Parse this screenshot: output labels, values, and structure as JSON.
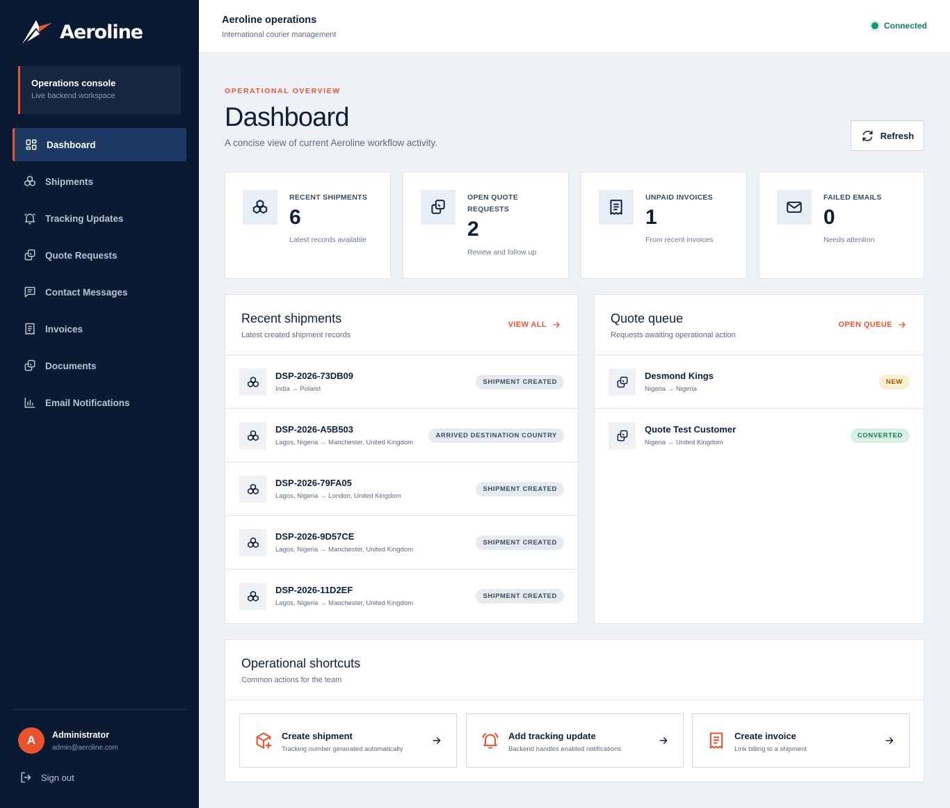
{
  "brand": {
    "name": "Aeroline"
  },
  "console": {
    "title": "Operations console",
    "subtitle": "Live backend workspace"
  },
  "nav": [
    {
      "label": "Dashboard",
      "icon": "dashboard-icon",
      "active": true
    },
    {
      "label": "Shipments",
      "icon": "boxes-icon"
    },
    {
      "label": "Tracking Updates",
      "icon": "bell-icon"
    },
    {
      "label": "Quote Requests",
      "icon": "copy-icon"
    },
    {
      "label": "Contact Messages",
      "icon": "message-icon"
    },
    {
      "label": "Invoices",
      "icon": "receipt-icon"
    },
    {
      "label": "Documents",
      "icon": "copy-icon"
    },
    {
      "label": "Email Notifications",
      "icon": "bar-chart-icon"
    }
  ],
  "user": {
    "initial": "A",
    "name": "Administrator",
    "email": "admin@aeroline.com"
  },
  "signout": {
    "label": "Sign out"
  },
  "topbar": {
    "title": "Aeroline operations",
    "subtitle": "International courier management",
    "status": "Connected"
  },
  "header": {
    "eyebrow": "OPERATIONAL OVERVIEW",
    "title": "Dashboard",
    "subtitle": "A concise view of current Aeroline workflow activity.",
    "refresh_label": "Refresh"
  },
  "stats": [
    {
      "label": "RECENT SHIPMENTS",
      "value": "6",
      "note": "Latest records available",
      "icon": "boxes-icon"
    },
    {
      "label": "OPEN QUOTE REQUESTS",
      "value": "2",
      "note": "Review and follow up",
      "icon": "copy-icon"
    },
    {
      "label": "UNPAID INVOICES",
      "value": "1",
      "note": "From recent invoices",
      "icon": "receipt-icon"
    },
    {
      "label": "FAILED EMAILS",
      "value": "0",
      "note": "Needs attention",
      "icon": "mail-icon"
    }
  ],
  "shipments_panel": {
    "title": "Recent shipments",
    "subtitle": "Latest created shipment records",
    "link": "VIEW ALL",
    "rows": [
      {
        "id": "DSP-2026-73DB09",
        "route": "India → Poland",
        "status": "SHIPMENT CREATED"
      },
      {
        "id": "DSP-2026-A5B503",
        "route": "Lagos, Nigeria → Manchester, United Kingdom",
        "status": "ARRIVED DESTINATION COUNTRY"
      },
      {
        "id": "DSP-2026-79FA05",
        "route": "Lagos, Nigeria → London, United Kingdom",
        "status": "SHIPMENT CREATED"
      },
      {
        "id": "DSP-2026-9D57CE",
        "route": "Lagos, Nigeria → Manchester, United Kingdom",
        "status": "SHIPMENT CREATED"
      },
      {
        "id": "DSP-2026-11D2EF",
        "route": "Lagos, Nigeria → Manchester, United Kingdom",
        "status": "SHIPMENT CREATED"
      }
    ]
  },
  "quotes_panel": {
    "title": "Quote queue",
    "subtitle": "Requests awaiting operational action",
    "link": "OPEN QUEUE",
    "rows": [
      {
        "name": "Desmond Kings",
        "route": "Nigeria → Nigeria",
        "status": "NEW"
      },
      {
        "name": "Quote Test Customer",
        "route": "Nigeria → United Kingdom",
        "status": "CONVERTED"
      }
    ]
  },
  "shortcuts_panel": {
    "title": "Operational shortcuts",
    "subtitle": "Common actions for the team",
    "items": [
      {
        "title": "Create shipment",
        "subtitle": "Tracking number generated automatically",
        "icon": "package-plus-icon"
      },
      {
        "title": "Add tracking update",
        "subtitle": "Backend handles enabled notifications",
        "icon": "bell-ring-icon"
      },
      {
        "title": "Create invoice",
        "subtitle": "Link billing to a shipment",
        "icon": "receipt-icon"
      }
    ]
  },
  "colors": {
    "sidebar": "#0b1a33",
    "accent": "#ea5330",
    "connected": "#1a9a68"
  }
}
